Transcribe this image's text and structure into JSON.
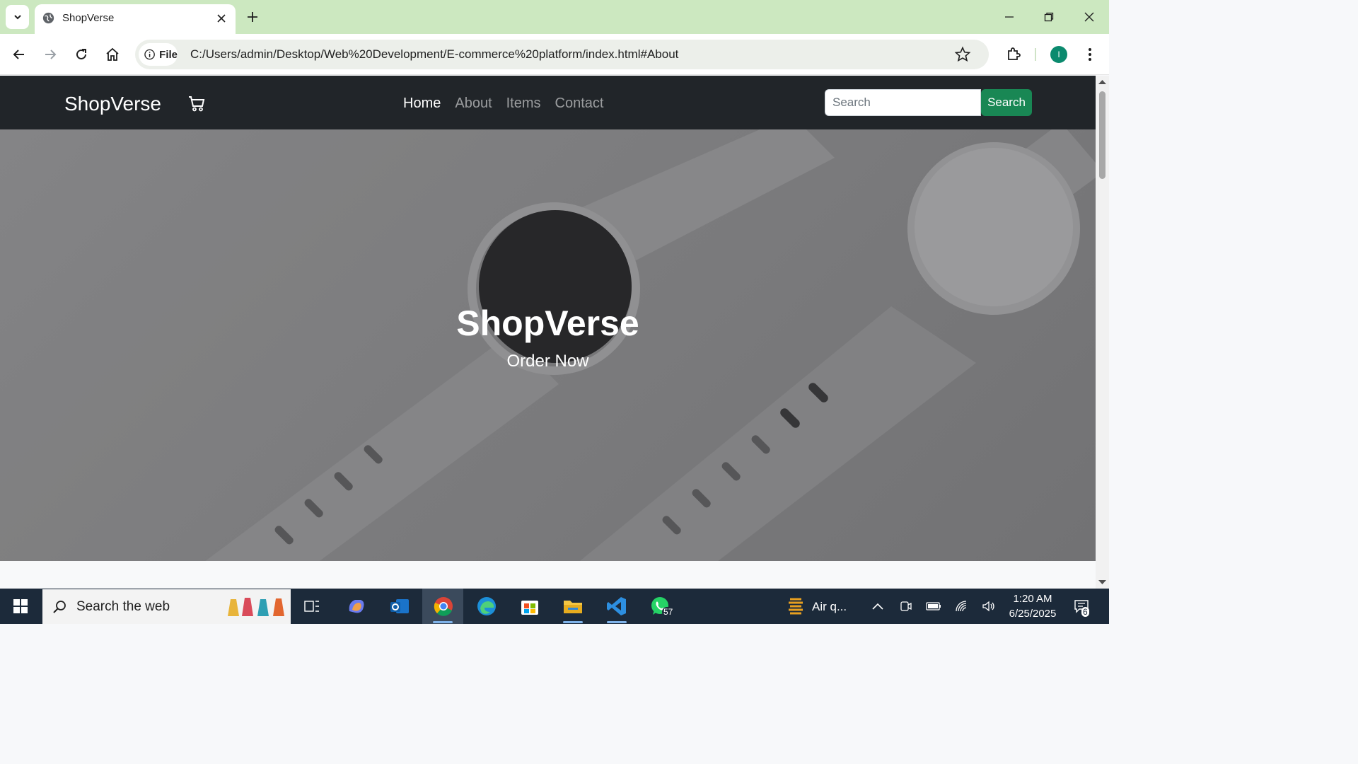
{
  "browser": {
    "tab_title": "ShopVerse",
    "site_chip_label": "File",
    "url": "C:/Users/admin/Desktop/Web%20Development/E-commerce%20platform/index.html#About",
    "profile_initial": "I"
  },
  "site": {
    "brand": "ShopVerse",
    "nav_links": [
      {
        "label": "Home",
        "active": true
      },
      {
        "label": "About",
        "active": false
      },
      {
        "label": "Items",
        "active": false
      },
      {
        "label": "Contact",
        "active": false
      }
    ],
    "search_placeholder": "Search",
    "search_button": "Search",
    "hero_title": "ShopVerse",
    "hero_subtitle": "Order Now"
  },
  "taskbar": {
    "search_placeholder": "Search the web",
    "whatsapp_badge": "57",
    "weather_text": "Air q...",
    "time": "1:20 AM",
    "date": "6/25/2025",
    "notification_count": "6"
  },
  "colors": {
    "tabstrip": "#cce8c0",
    "navbar": "#212529",
    "search_button": "#198754",
    "taskbar": "#1c2a3a"
  }
}
